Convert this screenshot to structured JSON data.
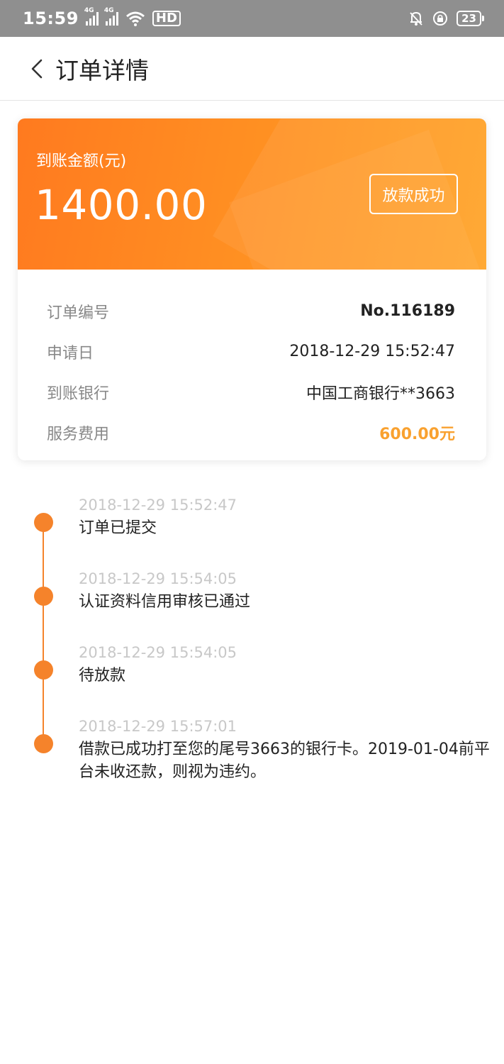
{
  "status_bar": {
    "time": "15:59",
    "network_1": "4G",
    "network_2": "4G",
    "hd_label": "HD",
    "battery": "23"
  },
  "header": {
    "title": "订单详情"
  },
  "card": {
    "amount_label": "到账金额(元)",
    "amount_value": "1400.00",
    "status": "放款成功",
    "rows": [
      {
        "label": "订单编号",
        "value": "No.116189"
      },
      {
        "label": "申请日",
        "value": "2018-12-29 15:52:47"
      },
      {
        "label": "到账银行",
        "value": "中国工商银行**3663"
      },
      {
        "label": "服务费用",
        "value": "600.00元"
      }
    ]
  },
  "timeline": [
    {
      "time": "2018-12-29 15:52:47",
      "text": "订单已提交"
    },
    {
      "time": "2018-12-29 15:54:05",
      "text": "认证资料信用审核已通过"
    },
    {
      "time": "2018-12-29 15:54:05",
      "text": "待放款"
    },
    {
      "time": "2018-12-29 15:57:01",
      "text": "借款已成功打至您的尾号3663的银行卡。2019-01-04前平台未收还款，则视为违约。"
    }
  ],
  "colors": {
    "accent": "#f5832b",
    "fee": "#f9a12f",
    "card_gradient_start": "#ff7a1f",
    "card_gradient_end": "#ffa326"
  }
}
